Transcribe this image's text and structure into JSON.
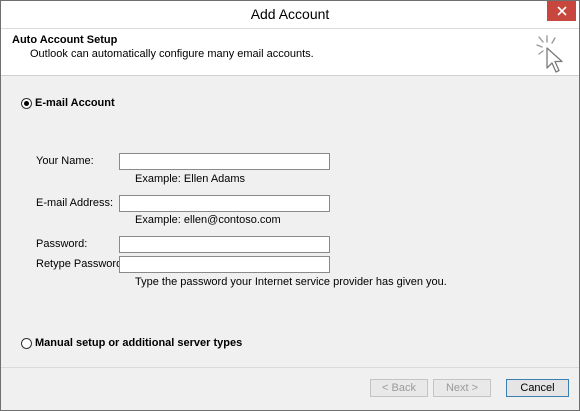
{
  "window": {
    "title": "Add Account",
    "close_icon": "close-icon"
  },
  "header": {
    "title": "Auto Account Setup",
    "subtitle": "Outlook can automatically configure many email accounts.",
    "icon": "wizard-cursor-icon"
  },
  "options": {
    "email_account": {
      "label": "E-mail Account",
      "selected": true
    },
    "manual_setup": {
      "label": "Manual setup or additional server types",
      "selected": false
    }
  },
  "form": {
    "name": {
      "label": "Your Name:",
      "value": "",
      "hint": "Example: Ellen Adams"
    },
    "email": {
      "label": "E-mail Address:",
      "value": "",
      "hint": "Example: ellen@contoso.com"
    },
    "password": {
      "label": "Password:",
      "value": ""
    },
    "retype": {
      "label": "Retype Password:",
      "value": "",
      "hint": "Type the password your Internet service provider has given you."
    }
  },
  "buttons": {
    "back": "< Back",
    "next": "Next >",
    "cancel": "Cancel"
  }
}
